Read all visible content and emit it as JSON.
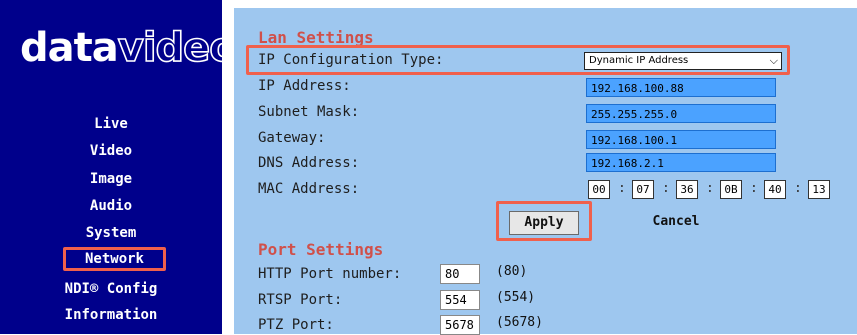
{
  "brand": {
    "logo_solid": "data",
    "logo_outline": "video"
  },
  "nav": [
    {
      "label": "Live"
    },
    {
      "label": "Video"
    },
    {
      "label": "Image"
    },
    {
      "label": "Audio"
    },
    {
      "label": "System"
    },
    {
      "label": "Network",
      "active": true
    },
    {
      "label": "NDI® Config"
    },
    {
      "label": "Information"
    }
  ],
  "lan": {
    "title": "Lan Settings",
    "ip_config_label": "IP Configuration Type:",
    "ip_config_value": "Dynamic IP Address",
    "ip_address_label": "IP Address:",
    "ip_address": "192.168.100.88",
    "subnet_label": "Subnet Mask:",
    "subnet": "255.255.255.0",
    "gateway_label": "Gateway:",
    "gateway": "192.168.100.1",
    "dns_label": "DNS Address:",
    "dns": "192.168.2.1",
    "mac_label": "MAC Address:",
    "mac": [
      "00",
      "07",
      "36",
      "0B",
      "40",
      "13"
    ],
    "apply_label": "Apply",
    "cancel_label": "Cancel"
  },
  "port": {
    "title": "Port Settings",
    "http_label": "HTTP Port number:",
    "http_value": "80",
    "http_default": "(80)",
    "rtsp_label": "RTSP Port:",
    "rtsp_value": "554",
    "rtsp_default": "(554)",
    "ptz_label": "PTZ Port:",
    "ptz_value": "5678",
    "ptz_default": "(5678)"
  },
  "colors": {
    "sidebar": "#00008b",
    "panel": "#9ec7ef",
    "field": "#4ba2ff",
    "highlight": "#f0604c",
    "section_title": "#d0504a"
  }
}
